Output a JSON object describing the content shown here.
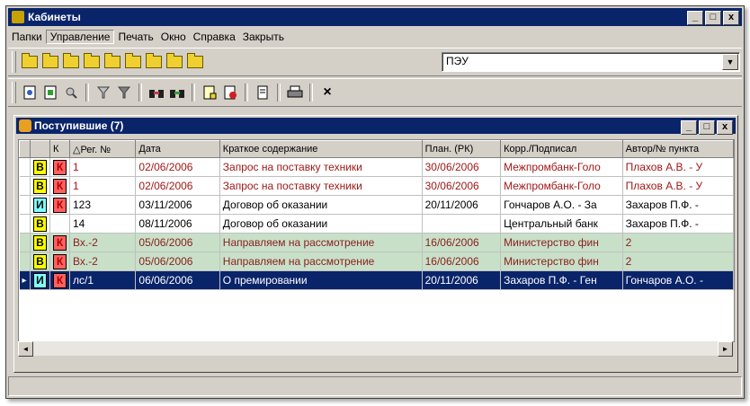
{
  "window": {
    "title": "Кабинеты",
    "min": "_",
    "max": "□",
    "close": "x"
  },
  "menu": [
    "Папки",
    "Управление",
    "Печать",
    "Окно",
    "Справка",
    "Закрыть"
  ],
  "toolbar": {
    "combo_value": "ПЭУ",
    "close_glyph": "×"
  },
  "child": {
    "title": "Поступившие (7)",
    "columns": [
      "",
      "",
      "К",
      "△Рег. №",
      "Дата",
      "Краткое содержание",
      "План. (РК)",
      "Корр./Подписал",
      "Автор/№ пункта"
    ],
    "rows": [
      {
        "style": "red",
        "ind": "",
        "t": "В",
        "tc": "yellow",
        "k": "К",
        "reg": "1",
        "date": "02/06/2006",
        "sum": "Запрос на поставку техники",
        "plan": "30/06/2006",
        "corr": "Межпромбанк-Голо",
        "author": "Плахов А.В. - У"
      },
      {
        "style": "red",
        "ind": "",
        "t": "В",
        "tc": "yellow",
        "k": "К",
        "reg": "1",
        "date": "02/06/2006",
        "sum": "Запрос на поставку техники",
        "plan": "30/06/2006",
        "corr": "Межпромбанк-Голо",
        "author": "Плахов А.В. - У"
      },
      {
        "style": "normal",
        "ind": "",
        "t": "И",
        "tc": "cyan",
        "k": "К",
        "reg": "123",
        "date": "03/11/2006",
        "sum": "Договор об оказании",
        "plan": "20/11/2006",
        "corr": "Гончаров А.О. - За",
        "author": "Захаров П.Ф. -"
      },
      {
        "style": "normal",
        "ind": "",
        "t": "В",
        "tc": "yellow",
        "k": "",
        "reg": "14",
        "date": "08/11/2006",
        "sum": "Договор об оказании",
        "plan": "",
        "corr": "Центральный банк",
        "author": "Захаров П.Ф. -"
      },
      {
        "style": "green",
        "ind": "",
        "t": "В",
        "tc": "yellow",
        "k": "К",
        "reg": "Вх.-2",
        "date": "05/06/2006",
        "sum": "Направляем на рассмотрение",
        "plan": "16/06/2006",
        "corr": "Министерство фин",
        "author": "2"
      },
      {
        "style": "green",
        "ind": "",
        "t": "В",
        "tc": "yellow",
        "k": "К",
        "reg": "Вх.-2",
        "date": "05/06/2006",
        "sum": "Направляем на рассмотрение",
        "plan": "16/06/2006",
        "corr": "Министерство фин",
        "author": "2"
      },
      {
        "style": "sel",
        "ind": "▸",
        "t": "И",
        "tc": "cyan",
        "k": "К",
        "reg": "лс/1",
        "date": "06/06/2006",
        "sum": "О премировании",
        "plan": "20/11/2006",
        "corr": "Захаров П.Ф. - Ген",
        "author": "Гончаров А.О. -"
      }
    ]
  },
  "scroll": {
    "left": "◄",
    "right": "►"
  },
  "icons": {
    "window": "app-icon",
    "child": "folder-incoming-icon"
  }
}
